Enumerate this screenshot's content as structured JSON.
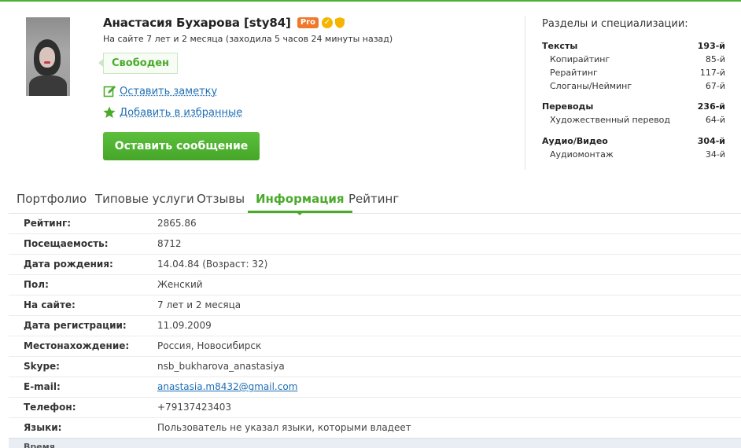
{
  "profile": {
    "name": "Анастасия Бухарова [sty84]",
    "pro_label": "Pro",
    "online_text": "На сайте 7 лет и 2 месяца (заходила 5 часов 24 минуты назад)",
    "status": "Свободен",
    "note_link": "Оставить заметку",
    "favorite_link": "Добавить в избранные",
    "message_button": "Оставить сообщение"
  },
  "icons": {
    "verified": "check-circle-icon",
    "shield": "shield-icon",
    "note": "pencil-icon",
    "favorite": "star-icon"
  },
  "colors": {
    "accent": "#4aaa2a",
    "pro": "#f0782b",
    "link": "#1f6fb5",
    "verified": "#f5b400"
  },
  "specializations": {
    "title": "Разделы и специализации:",
    "groups": [
      {
        "name": "Тексты",
        "rank": "193-й",
        "items": [
          {
            "name": "Копирайтинг",
            "rank": "85-й"
          },
          {
            "name": "Рерайтинг",
            "rank": "117-й"
          },
          {
            "name": "Слоганы/Нейминг",
            "rank": "67-й"
          }
        ]
      },
      {
        "name": "Переводы",
        "rank": "236-й",
        "items": [
          {
            "name": "Художественный перевод",
            "rank": "64-й"
          }
        ]
      },
      {
        "name": "Аудио/Видео",
        "rank": "304-й",
        "items": [
          {
            "name": "Аудиомонтаж",
            "rank": "34-й"
          }
        ]
      }
    ]
  },
  "tabs": [
    {
      "label": "Портфолио"
    },
    {
      "label": "Типовые услуги"
    },
    {
      "label": "Отзывы"
    },
    {
      "label": "Информация"
    },
    {
      "label": "Рейтинг"
    }
  ],
  "info": [
    {
      "key": "Рейтинг:",
      "value": "2865.86"
    },
    {
      "key": "Посещаемость:",
      "value": "8712"
    },
    {
      "key": "Дата рождения:",
      "value": "14.04.84 (Возраст: 32)"
    },
    {
      "key": "Пол:",
      "value": "Женский"
    },
    {
      "key": "На сайте:",
      "value": "7 лет и 2 месяца"
    },
    {
      "key": "Дата регистрации:",
      "value": "11.09.2009"
    },
    {
      "key": "Местонахождение:",
      "value": "Россия, Новосибирск"
    },
    {
      "key": "Skype:",
      "value": "nsb_bukharova_anastasiya"
    },
    {
      "key": "E-mail:",
      "value": "anastasia.m8432@gmail.com"
    },
    {
      "key": "Телефон:",
      "value": "+79137423403"
    },
    {
      "key": "Языки:",
      "value": "Пользователь не указал языки, которыми владеет"
    }
  ],
  "bottom_strip": "Время"
}
